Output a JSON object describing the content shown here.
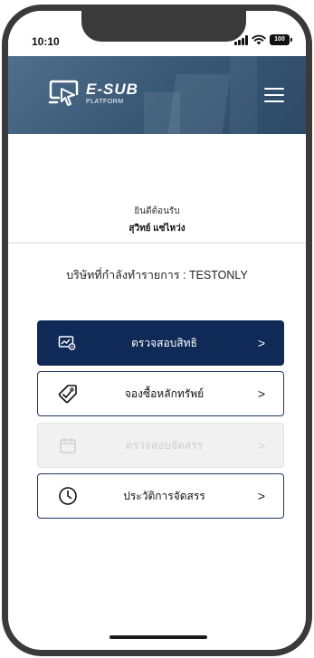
{
  "status_bar": {
    "time": "10:10",
    "battery": "100",
    "icons": [
      "signal-icon",
      "wifi-icon",
      "battery-icon"
    ]
  },
  "header": {
    "logo_title": "E-SUB",
    "logo_subtitle": "PLATFORM",
    "background_color": "#3d5d7b",
    "icons": [
      "logo-icon",
      "hamburger-menu-icon"
    ]
  },
  "welcome": {
    "label": "ยินดีต้อนรับ",
    "user_name": "สุวิทย์ แซ่ไหว่ง"
  },
  "company": {
    "text": "บริษัทที่กำลังทำรายการ : TESTONLY"
  },
  "menu": {
    "items": [
      {
        "label": "ตรวจสอบสิทธิ",
        "icon": "check-rights-icon",
        "chevron": ">",
        "state": "active"
      },
      {
        "label": "จองซื้อหลักทรัพย์",
        "icon": "tag-icon",
        "chevron": ">",
        "state": "normal"
      },
      {
        "label": "ตรวจสอบจัดสรร",
        "icon": "calendar-icon",
        "chevron": ">",
        "state": "disabled"
      },
      {
        "label": "ประวัติการจัดสรร",
        "icon": "clock-icon",
        "chevron": ">",
        "state": "normal"
      }
    ]
  },
  "colors": {
    "primary": "#0f2a57",
    "disabled_bg": "#f1f1f1",
    "disabled_text": "#cfcfcf"
  }
}
